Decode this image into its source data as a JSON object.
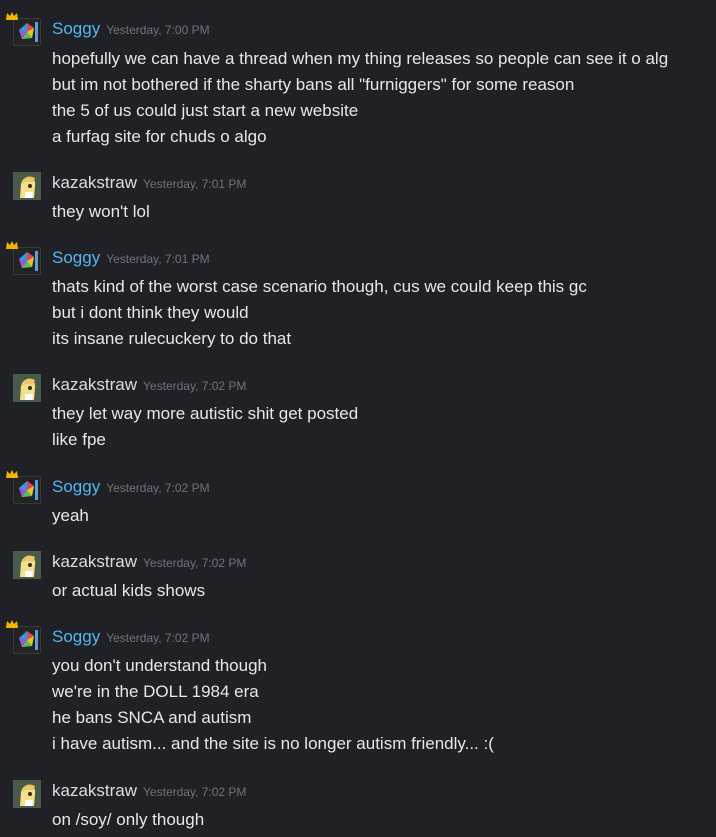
{
  "colors": {
    "background": "#1f2126",
    "soggy_name": "#56b6f0",
    "kazak_name": "#dcdde0",
    "timestamp": "#6f727a",
    "text": "#e6e7ea",
    "crown": "#f2b400"
  },
  "messages": [
    {
      "author": "Soggy",
      "time": "Yesterday, 7:00 PM",
      "lines": [
        "hopefully we can have a thread when my thing releases so people can see it o alg",
        "but im not bothered if the sharty bans all \"furniggers\" for some reason",
        "the 5 of us could just start a new website",
        "a furfag site for chuds o algo"
      ]
    },
    {
      "author": "kazakstraw",
      "time": "Yesterday, 7:01 PM",
      "lines": [
        "they won't lol"
      ]
    },
    {
      "author": "Soggy",
      "time": "Yesterday, 7:01 PM",
      "lines": [
        "thats kind of the worst case scenario though, cus we could keep this gc",
        "but i dont think they would",
        "its insane rulecuckery to do that"
      ]
    },
    {
      "author": "kazakstraw",
      "time": "Yesterday, 7:02 PM",
      "lines": [
        "they let way more autistic shit get posted",
        "like fpe"
      ]
    },
    {
      "author": "Soggy",
      "time": "Yesterday, 7:02 PM",
      "lines": [
        "yeah"
      ]
    },
    {
      "author": "kazakstraw",
      "time": "Yesterday, 7:02 PM",
      "lines": [
        "or actual kids shows"
      ]
    },
    {
      "author": "Soggy",
      "time": "Yesterday, 7:02 PM",
      "lines": [
        "you don't understand though",
        "we're in the DOLL 1984 era",
        "he bans SNCA and autism",
        "i have autism... and the site is no longer autism friendly... :("
      ]
    },
    {
      "author": "kazakstraw",
      "time": "Yesterday, 7:02 PM",
      "lines": [
        "on /soy/ only though"
      ]
    }
  ]
}
